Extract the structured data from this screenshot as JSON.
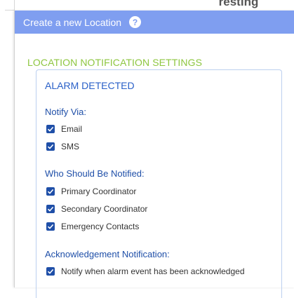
{
  "background": {
    "peek_text": "resting"
  },
  "modal": {
    "title": "Create a new Location",
    "help_glyph": "?"
  },
  "settings": {
    "section_title": "LOCATION NOTIFICATION SETTINGS",
    "panel_title": "ALARM DETECTED",
    "notify_via": {
      "label": "Notify Via:",
      "options": [
        {
          "label": "Email",
          "checked": true
        },
        {
          "label": "SMS",
          "checked": true
        }
      ]
    },
    "who_notified": {
      "label": "Who Should Be Notified:",
      "options": [
        {
          "label": "Primary Coordinator",
          "checked": true
        },
        {
          "label": "Secondary Coordinator",
          "checked": true
        },
        {
          "label": "Emergency Contacts",
          "checked": true
        }
      ]
    },
    "acknowledgement": {
      "label": "Acknowledgement Notification:",
      "options": [
        {
          "label": "Notify when alarm event has been acknowledged",
          "checked": true
        }
      ]
    }
  },
  "colors": {
    "header": "#7f9ef0",
    "section_title": "#8dc63f",
    "panel_title": "#2a60c8",
    "group_label": "#1f4fa8",
    "checkbox": "#1f4fa8"
  }
}
